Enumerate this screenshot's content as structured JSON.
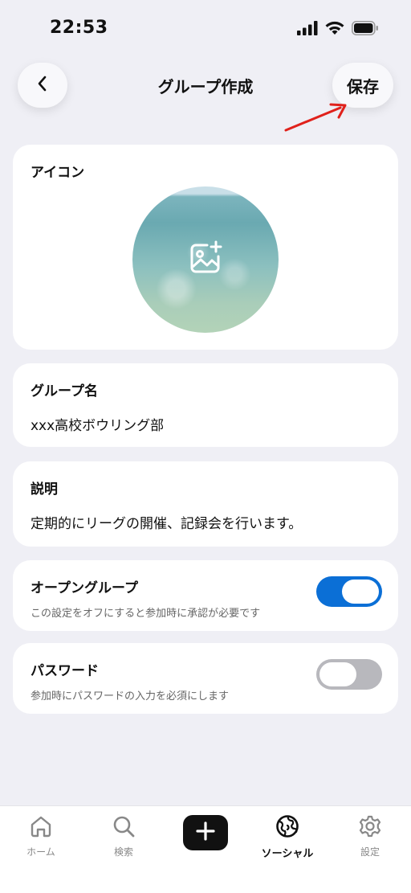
{
  "status_bar": {
    "time": "22:53",
    "icons": [
      "signal-icon",
      "wifi-icon",
      "battery-icon"
    ]
  },
  "header": {
    "title": "グループ作成",
    "back_icon": "chevron-left-icon",
    "save_label": "保存"
  },
  "annotation": {
    "arrow_color": "#e0211b",
    "arrow_icon": "red-arrow-annotation"
  },
  "icon_section": {
    "label": "アイコン",
    "add_photo_icon": "add-photo-icon"
  },
  "group_name": {
    "label": "グループ名",
    "value": "xxx高校ボウリング部"
  },
  "description": {
    "label": "説明",
    "value": "定期的にリーグの開催、記録会を行います。"
  },
  "open_group": {
    "label": "オープングループ",
    "sublabel": "この設定をオフにすると参加時に承認が必要です",
    "enabled": true
  },
  "password": {
    "label": "パスワード",
    "sublabel": "参加時にパスワードの入力を必須にします",
    "enabled": false
  },
  "tab_bar": {
    "items": [
      {
        "label": "ホーム",
        "icon": "home-icon",
        "active": false
      },
      {
        "label": "検索",
        "icon": "search-icon",
        "active": false
      },
      {
        "label": "",
        "icon": "plus-icon",
        "active": false
      },
      {
        "label": "ソーシャル",
        "icon": "globe-icon",
        "active": true
      },
      {
        "label": "設定",
        "icon": "gear-icon",
        "active": false
      }
    ]
  },
  "colors": {
    "background": "#efeff5",
    "toggle_on": "#0b6fd6",
    "toggle_off": "#b8b8bd",
    "plus_button": "#111111"
  }
}
